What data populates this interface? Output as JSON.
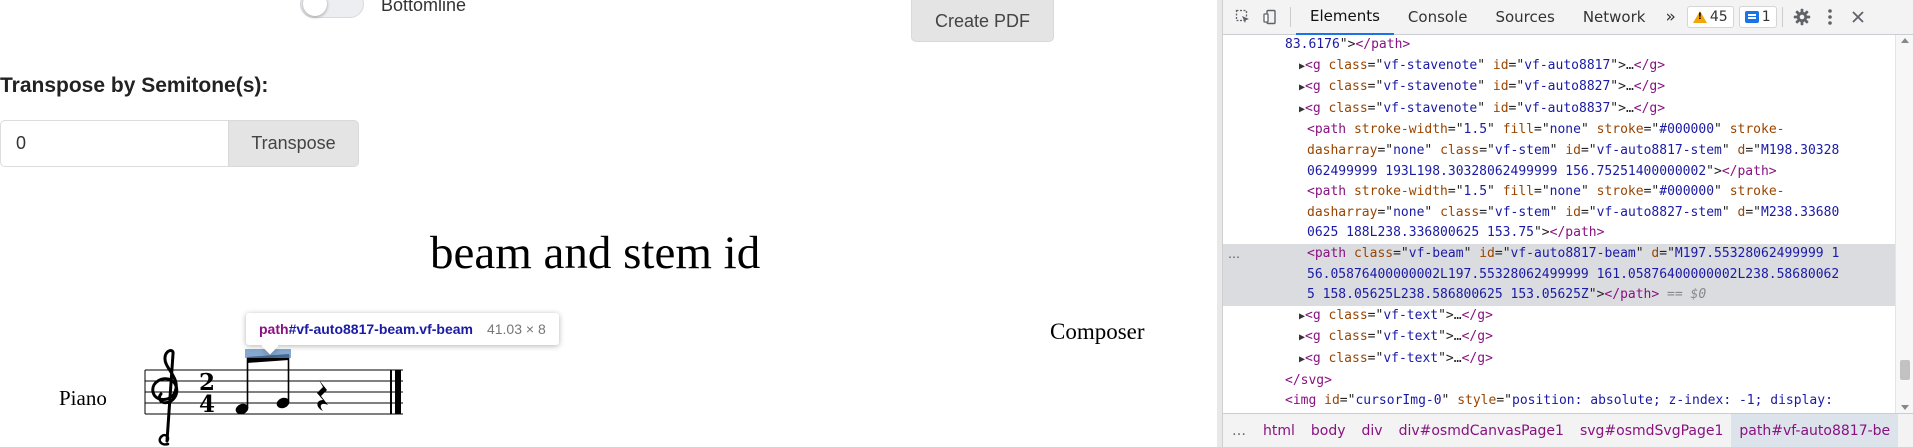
{
  "app": {
    "toggle_label": "Bottomline",
    "create_pdf_label": "Create PDF",
    "transpose_title": "Transpose by Semitone(s):",
    "transpose_value": "0",
    "transpose_button_label": "Transpose"
  },
  "score": {
    "title": "beam and stem id",
    "composer": "Composer",
    "part_name": "Piano",
    "time_signature": {
      "numerator": "2",
      "denominator": "4"
    },
    "clef": "treble"
  },
  "tooltip": {
    "tag": "path",
    "selector": "#vf-auto8817-beam.vf-beam",
    "size": "41.03 × 8"
  },
  "devtools": {
    "tabs": [
      "Elements",
      "Console",
      "Sources",
      "Network"
    ],
    "active_tab": "Elements",
    "more_tabs": "»",
    "warning_count": "45",
    "message_count": "1",
    "gutter_dots": "…",
    "tree": [
      {
        "indent": 0,
        "parts": [
          [
            "av",
            "83.6176"
          ],
          [
            "tx",
            "\">"
          ],
          [
            "tg",
            "</path>"
          ]
        ]
      },
      {
        "indent": 1,
        "toggle": true,
        "parts": [
          [
            "tg",
            "<g "
          ],
          [
            "an",
            "class"
          ],
          [
            "tx",
            "=\""
          ],
          [
            "av",
            "vf-stavenote"
          ],
          [
            "tx",
            "\" "
          ],
          [
            "an",
            "id"
          ],
          [
            "tx",
            "=\""
          ],
          [
            "av",
            "vf-auto8817"
          ],
          [
            "tx",
            "\">"
          ],
          [
            "tx",
            "…"
          ],
          [
            "tg",
            "</g>"
          ]
        ]
      },
      {
        "indent": 1,
        "toggle": true,
        "parts": [
          [
            "tg",
            "<g "
          ],
          [
            "an",
            "class"
          ],
          [
            "tx",
            "=\""
          ],
          [
            "av",
            "vf-stavenote"
          ],
          [
            "tx",
            "\" "
          ],
          [
            "an",
            "id"
          ],
          [
            "tx",
            "=\""
          ],
          [
            "av",
            "vf-auto8827"
          ],
          [
            "tx",
            "\">"
          ],
          [
            "tx",
            "…"
          ],
          [
            "tg",
            "</g>"
          ]
        ]
      },
      {
        "indent": 1,
        "toggle": true,
        "parts": [
          [
            "tg",
            "<g "
          ],
          [
            "an",
            "class"
          ],
          [
            "tx",
            "=\""
          ],
          [
            "av",
            "vf-stavenote"
          ],
          [
            "tx",
            "\" "
          ],
          [
            "an",
            "id"
          ],
          [
            "tx",
            "=\""
          ],
          [
            "av",
            "vf-auto8837"
          ],
          [
            "tx",
            "\">"
          ],
          [
            "tx",
            "…"
          ],
          [
            "tg",
            "</g>"
          ]
        ]
      },
      {
        "indent": 2,
        "parts": [
          [
            "tg",
            "<path "
          ],
          [
            "an",
            "stroke-width"
          ],
          [
            "tx",
            "=\""
          ],
          [
            "av",
            "1.5"
          ],
          [
            "tx",
            "\" "
          ],
          [
            "an",
            "fill"
          ],
          [
            "tx",
            "=\""
          ],
          [
            "av",
            "none"
          ],
          [
            "tx",
            "\" "
          ],
          [
            "an",
            "stroke"
          ],
          [
            "tx",
            "=\""
          ],
          [
            "av",
            "#000000"
          ],
          [
            "tx",
            "\" "
          ],
          [
            "an",
            "stroke-"
          ]
        ]
      },
      {
        "indent": 2,
        "parts": [
          [
            "an",
            "dasharray"
          ],
          [
            "tx",
            "=\""
          ],
          [
            "av",
            "none"
          ],
          [
            "tx",
            "\" "
          ],
          [
            "an",
            "class"
          ],
          [
            "tx",
            "=\""
          ],
          [
            "av",
            "vf-stem"
          ],
          [
            "tx",
            "\" "
          ],
          [
            "an",
            "id"
          ],
          [
            "tx",
            "=\""
          ],
          [
            "av",
            "vf-auto8817-stem"
          ],
          [
            "tx",
            "\" "
          ],
          [
            "an",
            "d"
          ],
          [
            "tx",
            "=\""
          ],
          [
            "av",
            "M198.30328"
          ]
        ]
      },
      {
        "indent": 2,
        "parts": [
          [
            "av",
            "062499999 193L198.30328062499999 156.75251400000002"
          ],
          [
            "tx",
            "\">"
          ],
          [
            "tg",
            "</path>"
          ]
        ]
      },
      {
        "indent": 2,
        "parts": [
          [
            "tg",
            "<path "
          ],
          [
            "an",
            "stroke-width"
          ],
          [
            "tx",
            "=\""
          ],
          [
            "av",
            "1.5"
          ],
          [
            "tx",
            "\" "
          ],
          [
            "an",
            "fill"
          ],
          [
            "tx",
            "=\""
          ],
          [
            "av",
            "none"
          ],
          [
            "tx",
            "\" "
          ],
          [
            "an",
            "stroke"
          ],
          [
            "tx",
            "=\""
          ],
          [
            "av",
            "#000000"
          ],
          [
            "tx",
            "\" "
          ],
          [
            "an",
            "stroke-"
          ]
        ]
      },
      {
        "indent": 2,
        "parts": [
          [
            "an",
            "dasharray"
          ],
          [
            "tx",
            "=\""
          ],
          [
            "av",
            "none"
          ],
          [
            "tx",
            "\" "
          ],
          [
            "an",
            "class"
          ],
          [
            "tx",
            "=\""
          ],
          [
            "av",
            "vf-stem"
          ],
          [
            "tx",
            "\" "
          ],
          [
            "an",
            "id"
          ],
          [
            "tx",
            "=\""
          ],
          [
            "av",
            "vf-auto8827-stem"
          ],
          [
            "tx",
            "\" "
          ],
          [
            "an",
            "d"
          ],
          [
            "tx",
            "=\""
          ],
          [
            "av",
            "M238.33680"
          ]
        ]
      },
      {
        "indent": 2,
        "parts": [
          [
            "av",
            "0625 188L238.336800625 153.75"
          ],
          [
            "tx",
            "\">"
          ],
          [
            "tg",
            "</path>"
          ]
        ]
      },
      {
        "indent": 2,
        "selected": true,
        "gutter": true,
        "parts": [
          [
            "tg",
            "<path "
          ],
          [
            "an",
            "class"
          ],
          [
            "tx",
            "=\""
          ],
          [
            "av",
            "vf-beam"
          ],
          [
            "tx",
            "\" "
          ],
          [
            "an",
            "id"
          ],
          [
            "tx",
            "=\""
          ],
          [
            "av",
            "vf-auto8817-beam"
          ],
          [
            "tx",
            "\" "
          ],
          [
            "an",
            "d"
          ],
          [
            "tx",
            "=\""
          ],
          [
            "av",
            "M197.55328062499999 1"
          ]
        ]
      },
      {
        "indent": 2,
        "selected": true,
        "parts": [
          [
            "av",
            "56.05876400000002L197.55328062499999 161.05876400000002L238.58680062"
          ]
        ]
      },
      {
        "indent": 2,
        "selected": true,
        "parts": [
          [
            "av",
            "5 158.05625L238.586800625 153.05625Z"
          ],
          [
            "tx",
            "\">"
          ],
          [
            "tg",
            "</path>"
          ],
          [
            "eq",
            " == $0"
          ]
        ]
      },
      {
        "indent": 1,
        "toggle": true,
        "parts": [
          [
            "tg",
            "<g "
          ],
          [
            "an",
            "class"
          ],
          [
            "tx",
            "=\""
          ],
          [
            "av",
            "vf-text"
          ],
          [
            "tx",
            "\">"
          ],
          [
            "tx",
            "…"
          ],
          [
            "tg",
            "</g>"
          ]
        ]
      },
      {
        "indent": 1,
        "toggle": true,
        "parts": [
          [
            "tg",
            "<g "
          ],
          [
            "an",
            "class"
          ],
          [
            "tx",
            "=\""
          ],
          [
            "av",
            "vf-text"
          ],
          [
            "tx",
            "\">"
          ],
          [
            "tx",
            "…"
          ],
          [
            "tg",
            "</g>"
          ]
        ]
      },
      {
        "indent": 1,
        "toggle": true,
        "parts": [
          [
            "tg",
            "<g "
          ],
          [
            "an",
            "class"
          ],
          [
            "tx",
            "=\""
          ],
          [
            "av",
            "vf-text"
          ],
          [
            "tx",
            "\">"
          ],
          [
            "tx",
            "…"
          ],
          [
            "tg",
            "</g>"
          ]
        ]
      },
      {
        "indent": 0,
        "parts": [
          [
            "tg",
            "</svg>"
          ]
        ]
      },
      {
        "indent": 0,
        "parts": [
          [
            "tg",
            "<img "
          ],
          [
            "an",
            "id"
          ],
          [
            "tx",
            "=\""
          ],
          [
            "av",
            "cursorImg-0"
          ],
          [
            "tx",
            "\" "
          ],
          [
            "an",
            "style"
          ],
          [
            "tx",
            "=\""
          ],
          [
            "av",
            "position: absolute; z-index: -1; display: "
          ]
        ]
      }
    ],
    "breadcrumbs": [
      {
        "tag": "…",
        "id": "",
        "more": true
      },
      {
        "tag": "html",
        "id": ""
      },
      {
        "tag": "body",
        "id": ""
      },
      {
        "tag": "div",
        "id": ""
      },
      {
        "tag": "div",
        "id": "#osmdCanvasPage1"
      },
      {
        "tag": "svg",
        "id": "#osmdSvgPage1"
      },
      {
        "tag": "path",
        "id": "#vf-auto8817-be",
        "active": true
      }
    ],
    "colors": {
      "accent": "#1a73e8",
      "warning": "#f2a60c",
      "tag": "#881280",
      "attr_name": "#994500",
      "attr_value": "#1a1aa6",
      "selection": "#dadce0"
    }
  }
}
